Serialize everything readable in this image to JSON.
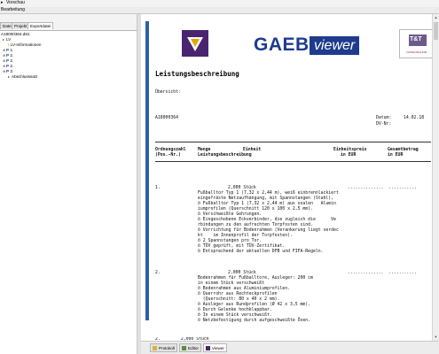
{
  "title_bar": {
    "menu_label": "Vorschau",
    "icon": "app-icon"
  },
  "toolbar": {
    "label": "Bearbeitung"
  },
  "left_panel": {
    "tabs": [
      "Datei",
      "Projekt",
      "Exportdatei"
    ],
    "active_tab": 2,
    "tree": {
      "root": "A18000364.d81",
      "lv": "LV",
      "info": "LV-Informationen",
      "positions": [
        {
          "prefix": "P",
          "label": "1."
        },
        {
          "prefix": "P",
          "label": "2."
        },
        {
          "prefix": "P",
          "label": "2."
        },
        {
          "prefix": "P",
          "label": "2."
        },
        {
          "prefix": "P",
          "label": "3."
        }
      ],
      "end": "Abschlusssatz"
    }
  },
  "logo": {
    "gaeb": "GAEB",
    "viewer": "viewer",
    "tt": "T&T",
    "tt_sub": "DATENTECHNIK"
  },
  "document": {
    "title": "Leistungsbeschreibung",
    "uebersicht": "Übersicht:",
    "doc_number": "A18000364",
    "datum_label": "Datum:",
    "datum_value": "14.02.18",
    "dvnr_label": "DV-Nr:",
    "col_headers": {
      "ordnungszahl": "Ordnungszahl",
      "pos_nr": "(Pos.-Nr.)",
      "menge": "Menge",
      "einheit": "Einheit",
      "leistungsbeschreibung": "Leistungsbeschreibung",
      "einheitspreis": "Einheitspreis",
      "gesamtbetrag": "Gesamtbetrag",
      "in_eur": "in EUR",
      "in_eur2": "in EUR"
    },
    "positions": [
      {
        "oz": "1.",
        "menge": "2,000 Stück",
        "dots": "..............  ...........",
        "lines": [
          "Fußballtor Typ 1 (7,32 x 2,44 m), weiß einbrennlackiert",
          "eingefräste Netzaufhängung, mit Spannstangen (Stahl),",
          "ö Fußballtor Typ 1 (7,32 x 2,44 m) aus ovalen   Alumin",
          "iumprofilen (Querschnitt 120 x 100 x 2,5 mm).",
          "ö Verschweißte Gehrungen.",
          "ö Eingeschobene Eckverbinder, die zugleich die      Ve",
          "rbindungen zu den aufrechten Torpfosten sind.",
          "ö Vorrichtung für Bodenrahmen (Verankerung liegt verdec",
          "kt    im Innenprofil der Torpfosten).",
          "ö 2 Spannstangen pro Tor.",
          "ö TÜV geprüft, mit TÜV-Zertifikat.",
          "ö Entsprechend der aktuellen DFB und FIFA-Regeln."
        ]
      },
      {
        "oz": "2.",
        "menge": "2,000 Stück",
        "dots": "..............  ...........",
        "lines": [
          "Bodenrahmen für Fußballtore, Ausleger: 200 cm",
          "in einem Stück verschweißt",
          "ö Bodenrahmen aus Aluminiumprofilen.",
          "ö Querrohr aus Rechteckprofilen",
          "  (Querschnitt: 80 x 40 x 2 mm).",
          "ö Ausleger aus Rundprofilen (Ø 42 x 3,5 mm).",
          "ö Durch Gelenke hochklappbar.",
          "ö In einem Stück verschweißt.",
          "ö Netzbefestigung durch aufgeschweißte Ösen."
        ]
      }
    ],
    "partial_line": "2.        2,000 Stück"
  },
  "bottom_tabs": [
    {
      "label": "Protokoll",
      "icon": "protocol-icon"
    },
    {
      "label": "Editor",
      "icon": "editor-icon"
    },
    {
      "label": "Viewer",
      "icon": "viewer-icon"
    }
  ],
  "colors": {
    "accent": "#1f3b8e",
    "logo_purple": "#4a2470",
    "tt_red": "#9a1d2e",
    "side_bar": "#2e5fa8"
  }
}
